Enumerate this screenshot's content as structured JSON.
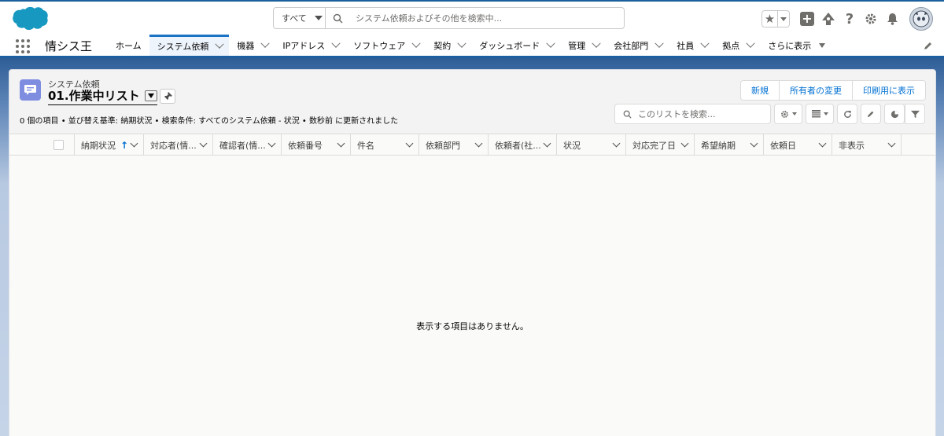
{
  "header": {
    "search_scope": "すべて",
    "search_placeholder": "システム依頼およびその他を検索中..."
  },
  "nav": {
    "app_name": "情シス王",
    "items": [
      {
        "label": "ホーム"
      },
      {
        "label": "システム依頼"
      },
      {
        "label": "機器"
      },
      {
        "label": "IPアドレス"
      },
      {
        "label": "ソフトウェア"
      },
      {
        "label": "契約"
      },
      {
        "label": "ダッシュボード"
      },
      {
        "label": "管理"
      },
      {
        "label": "会社部門"
      },
      {
        "label": "社員"
      },
      {
        "label": "拠点"
      }
    ],
    "more_label": "さらに表示"
  },
  "list": {
    "object_label": "システム依頼",
    "view_name": "01.作業中リスト",
    "buttons": {
      "new": "新規",
      "change_owner": "所有者の変更",
      "print": "印刷用に表示"
    },
    "meta": "0 個の項目 • 並び替え基準: 納期状況 • 検索条件: すべてのシステム依頼 - 状況 • 数秒前 に更新されました",
    "search_placeholder": "このリストを検索...",
    "columns": [
      {
        "label": "納期状況"
      },
      {
        "label": "対応者(情..."
      },
      {
        "label": "確認者(情..."
      },
      {
        "label": "依頼番号"
      },
      {
        "label": "件名"
      },
      {
        "label": "依頼部門"
      },
      {
        "label": "依頼者(社..."
      },
      {
        "label": "状況"
      },
      {
        "label": "対応完了日"
      },
      {
        "label": "希望納期"
      },
      {
        "label": "依頼日"
      },
      {
        "label": "非表示"
      }
    ],
    "empty_message": "表示する項目はありません。"
  },
  "colors": {
    "brand": "#1b5f9e",
    "link": "#0070d2",
    "object_icon": "#7f8de1"
  }
}
